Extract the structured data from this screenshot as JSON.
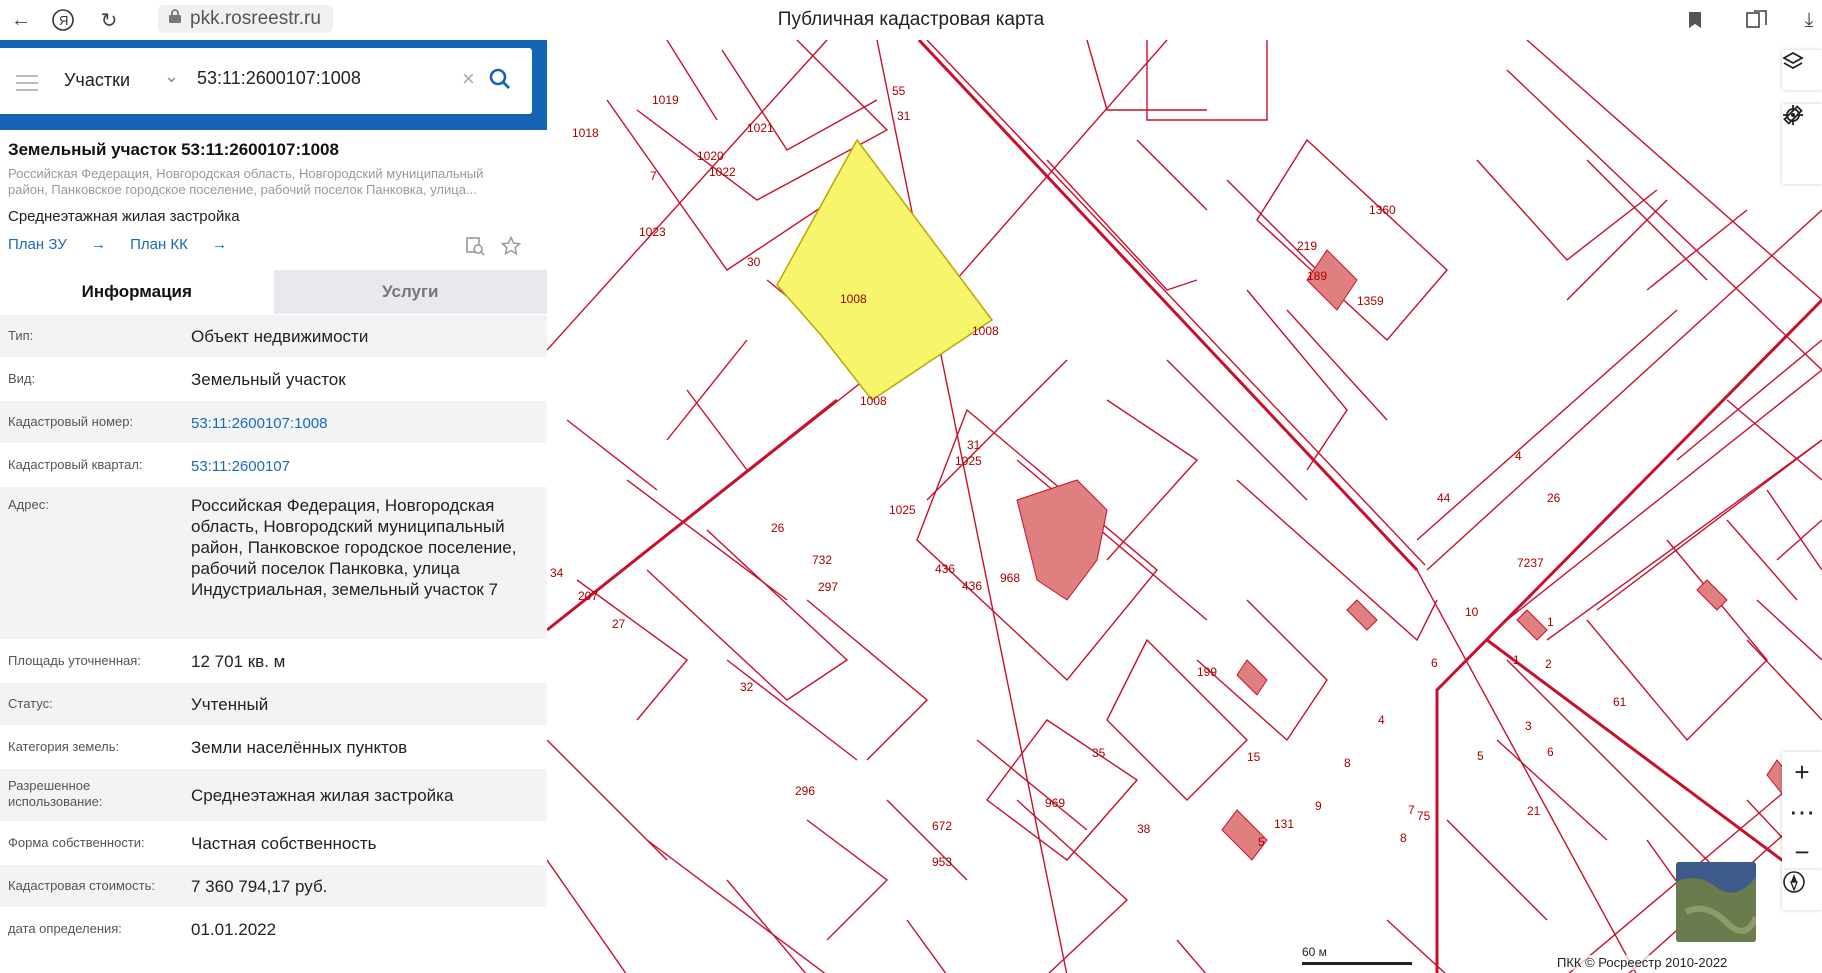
{
  "browser": {
    "url": "pkk.rosreestr.ru",
    "tab_title": "Публичная кадастровая карта"
  },
  "search": {
    "layer_select": "Участки",
    "query": "53:11:2600107:1008"
  },
  "object": {
    "title": "Земельный участок 53:11:2600107:1008",
    "address_short": "Российская Федерация, Новгородская область, Новгородский муниципальный район, Панковское городское поселение, рабочий поселок Панковка, улица...",
    "usage": "Среднеэтажная жилая застройка",
    "link_plan_zu": "План ЗУ",
    "link_plan_kk": "План КК"
  },
  "tabs": {
    "info": "Информация",
    "services": "Услуги"
  },
  "rows": [
    {
      "label": "Тип:",
      "value": "Объект недвижимости"
    },
    {
      "label": "Вид:",
      "value": "Земельный участок"
    },
    {
      "label": "Кадастровый номер:",
      "value": "53:11:2600107:1008"
    },
    {
      "label": "Кадастровый квартал:",
      "value": "53:11:2600107"
    },
    {
      "label": "Адрес:",
      "value": "Российская Федерация, Новгородская область, Новгородский муниципальный район, Панковское городское поселение, рабочий поселок Панковка, улица Индустриальная, земельный участок 7"
    },
    {
      "label": "Площадь уточненная:",
      "value": "12 701 кв. м"
    },
    {
      "label": "Статус:",
      "value": "Учтенный"
    },
    {
      "label": "Категория земель:",
      "value": "Земли населённых пунктов"
    },
    {
      "label": "Разрешенное использование:",
      "value": "Среднеэтажная жилая застройка"
    },
    {
      "label": "Форма собственности:",
      "value": "Частная собственность"
    },
    {
      "label": "Кадастровая стоимость:",
      "value": "7 360 794,17 руб."
    },
    {
      "label": "дата определения:",
      "value": "01.01.2022"
    }
  ],
  "map": {
    "scale": "60 м",
    "copyright": "ПКК © Росреестр 2010-2022",
    "labels": [
      "1019",
      "1018",
      "1021",
      "1020",
      "1022",
      "7",
      "1023",
      "30",
      "55",
      "31",
      "1008",
      "1008",
      "1008",
      "1025",
      "1025",
      "26",
      "34",
      "207",
      "27",
      "732",
      "297",
      "32",
      "436",
      "436",
      "968",
      "31",
      "199",
      "35",
      "969",
      "296",
      "672",
      "953",
      "38",
      "15",
      "1360",
      "219",
      "189",
      "1359",
      "44",
      "4",
      "26",
      "7237",
      "10",
      "6",
      "1",
      "61",
      "4",
      "8",
      "9",
      "5",
      "6",
      "7",
      "3",
      "21",
      "131",
      "5",
      "8",
      "75",
      "1",
      "2"
    ],
    "highlight_color": "#f7f56c",
    "line_color": "#c8102e"
  }
}
